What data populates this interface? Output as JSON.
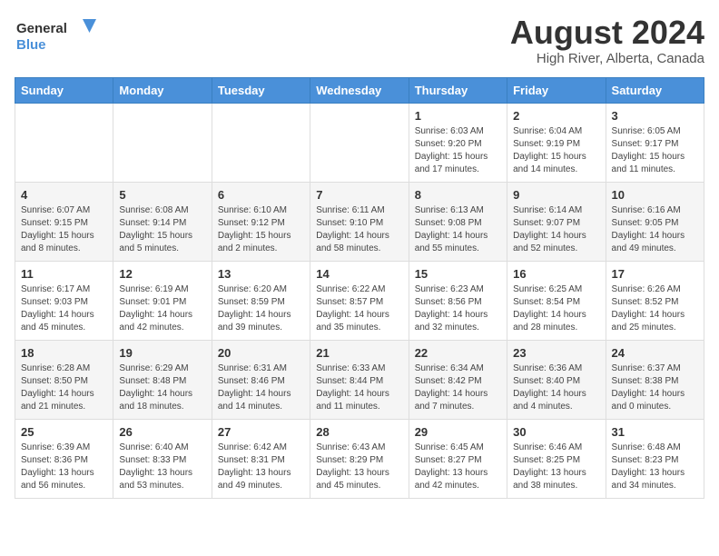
{
  "logo": {
    "line1": "General",
    "line2": "Blue"
  },
  "title": "August 2024",
  "location": "High River, Alberta, Canada",
  "weekdays": [
    "Sunday",
    "Monday",
    "Tuesday",
    "Wednesday",
    "Thursday",
    "Friday",
    "Saturday"
  ],
  "weeks": [
    [
      {
        "day": "",
        "info": ""
      },
      {
        "day": "",
        "info": ""
      },
      {
        "day": "",
        "info": ""
      },
      {
        "day": "",
        "info": ""
      },
      {
        "day": "1",
        "info": "Sunrise: 6:03 AM\nSunset: 9:20 PM\nDaylight: 15 hours and 17 minutes."
      },
      {
        "day": "2",
        "info": "Sunrise: 6:04 AM\nSunset: 9:19 PM\nDaylight: 15 hours and 14 minutes."
      },
      {
        "day": "3",
        "info": "Sunrise: 6:05 AM\nSunset: 9:17 PM\nDaylight: 15 hours and 11 minutes."
      }
    ],
    [
      {
        "day": "4",
        "info": "Sunrise: 6:07 AM\nSunset: 9:15 PM\nDaylight: 15 hours and 8 minutes."
      },
      {
        "day": "5",
        "info": "Sunrise: 6:08 AM\nSunset: 9:14 PM\nDaylight: 15 hours and 5 minutes."
      },
      {
        "day": "6",
        "info": "Sunrise: 6:10 AM\nSunset: 9:12 PM\nDaylight: 15 hours and 2 minutes."
      },
      {
        "day": "7",
        "info": "Sunrise: 6:11 AM\nSunset: 9:10 PM\nDaylight: 14 hours and 58 minutes."
      },
      {
        "day": "8",
        "info": "Sunrise: 6:13 AM\nSunset: 9:08 PM\nDaylight: 14 hours and 55 minutes."
      },
      {
        "day": "9",
        "info": "Sunrise: 6:14 AM\nSunset: 9:07 PM\nDaylight: 14 hours and 52 minutes."
      },
      {
        "day": "10",
        "info": "Sunrise: 6:16 AM\nSunset: 9:05 PM\nDaylight: 14 hours and 49 minutes."
      }
    ],
    [
      {
        "day": "11",
        "info": "Sunrise: 6:17 AM\nSunset: 9:03 PM\nDaylight: 14 hours and 45 minutes."
      },
      {
        "day": "12",
        "info": "Sunrise: 6:19 AM\nSunset: 9:01 PM\nDaylight: 14 hours and 42 minutes."
      },
      {
        "day": "13",
        "info": "Sunrise: 6:20 AM\nSunset: 8:59 PM\nDaylight: 14 hours and 39 minutes."
      },
      {
        "day": "14",
        "info": "Sunrise: 6:22 AM\nSunset: 8:57 PM\nDaylight: 14 hours and 35 minutes."
      },
      {
        "day": "15",
        "info": "Sunrise: 6:23 AM\nSunset: 8:56 PM\nDaylight: 14 hours and 32 minutes."
      },
      {
        "day": "16",
        "info": "Sunrise: 6:25 AM\nSunset: 8:54 PM\nDaylight: 14 hours and 28 minutes."
      },
      {
        "day": "17",
        "info": "Sunrise: 6:26 AM\nSunset: 8:52 PM\nDaylight: 14 hours and 25 minutes."
      }
    ],
    [
      {
        "day": "18",
        "info": "Sunrise: 6:28 AM\nSunset: 8:50 PM\nDaylight: 14 hours and 21 minutes."
      },
      {
        "day": "19",
        "info": "Sunrise: 6:29 AM\nSunset: 8:48 PM\nDaylight: 14 hours and 18 minutes."
      },
      {
        "day": "20",
        "info": "Sunrise: 6:31 AM\nSunset: 8:46 PM\nDaylight: 14 hours and 14 minutes."
      },
      {
        "day": "21",
        "info": "Sunrise: 6:33 AM\nSunset: 8:44 PM\nDaylight: 14 hours and 11 minutes."
      },
      {
        "day": "22",
        "info": "Sunrise: 6:34 AM\nSunset: 8:42 PM\nDaylight: 14 hours and 7 minutes."
      },
      {
        "day": "23",
        "info": "Sunrise: 6:36 AM\nSunset: 8:40 PM\nDaylight: 14 hours and 4 minutes."
      },
      {
        "day": "24",
        "info": "Sunrise: 6:37 AM\nSunset: 8:38 PM\nDaylight: 14 hours and 0 minutes."
      }
    ],
    [
      {
        "day": "25",
        "info": "Sunrise: 6:39 AM\nSunset: 8:36 PM\nDaylight: 13 hours and 56 minutes."
      },
      {
        "day": "26",
        "info": "Sunrise: 6:40 AM\nSunset: 8:33 PM\nDaylight: 13 hours and 53 minutes."
      },
      {
        "day": "27",
        "info": "Sunrise: 6:42 AM\nSunset: 8:31 PM\nDaylight: 13 hours and 49 minutes."
      },
      {
        "day": "28",
        "info": "Sunrise: 6:43 AM\nSunset: 8:29 PM\nDaylight: 13 hours and 45 minutes."
      },
      {
        "day": "29",
        "info": "Sunrise: 6:45 AM\nSunset: 8:27 PM\nDaylight: 13 hours and 42 minutes."
      },
      {
        "day": "30",
        "info": "Sunrise: 6:46 AM\nSunset: 8:25 PM\nDaylight: 13 hours and 38 minutes."
      },
      {
        "day": "31",
        "info": "Sunrise: 6:48 AM\nSunset: 8:23 PM\nDaylight: 13 hours and 34 minutes."
      }
    ]
  ]
}
